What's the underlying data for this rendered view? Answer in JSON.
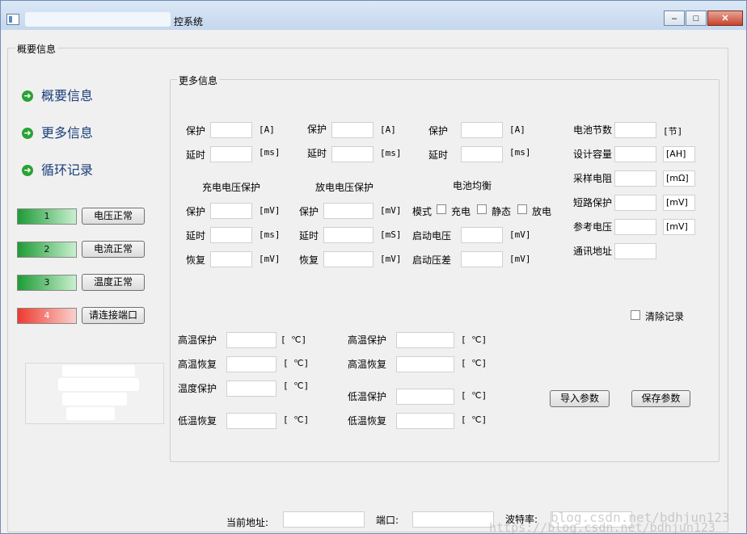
{
  "window": {
    "title": "控系统",
    "buttons": {
      "minimize": "–",
      "maximize": "□",
      "close": "✕"
    }
  },
  "overview_group_title": "概要信息",
  "sidebar": {
    "items": [
      {
        "label": "概要信息",
        "icon": "arrow-right-icon"
      },
      {
        "label": "更多信息",
        "icon": "arrow-right-icon"
      },
      {
        "label": "循环记录",
        "icon": "arrow-right-icon"
      }
    ]
  },
  "status": [
    {
      "num": "1",
      "label": "电压正常",
      "color": "#1e9b36"
    },
    {
      "num": "2",
      "label": "电流正常",
      "color": "#1e9b36"
    },
    {
      "num": "3",
      "label": "温度正常",
      "color": "#1e9b36"
    },
    {
      "num": "4",
      "label": "请连接端口",
      "color": "#ee3a2f"
    }
  ],
  "more": {
    "title": "更多信息",
    "current": [
      {
        "protect": "保护",
        "unit_a": "[A]",
        "delay": "延时",
        "unit_ms": "[ms]"
      },
      {
        "protect": "保护",
        "unit_a": "[A]",
        "delay": "延时",
        "unit_ms": "[ms]"
      },
      {
        "protect": "保护",
        "unit_a": "[A]",
        "delay": "延时",
        "unit_ms": "[ms]"
      }
    ],
    "charge": {
      "title": "充电电压保护",
      "protect": "保护",
      "protect_unit": "[mV]",
      "delay": "延时",
      "delay_unit": "[ms]",
      "recover": "恢复",
      "recover_unit": "[mV]"
    },
    "discharge": {
      "title": "放电电压保护",
      "protect": "保护",
      "protect_unit": "[mV]",
      "delay": "延时",
      "delay_unit": "[mS]",
      "recover": "恢复",
      "recover_unit": "[mV]"
    },
    "balance": {
      "title": "电池均衡",
      "mode": "模式",
      "opt_charge": "充电",
      "opt_static": "静态",
      "opt_discharge": "放电",
      "start_voltage": "启动电压",
      "start_voltage_unit": "[mV]",
      "start_diff": "启动压差",
      "start_diff_unit": "[mV]"
    },
    "battery": [
      {
        "label": "电池节数",
        "unit": "[节]"
      },
      {
        "label": "设计容量",
        "unit": "[AH]"
      },
      {
        "label": "采样电阻",
        "unit": "[mΩ]"
      },
      {
        "label": "短路保护",
        "unit": "[mV]"
      },
      {
        "label": "参考电压",
        "unit": "[mV]"
      },
      {
        "label": "通讯地址",
        "unit": ""
      }
    ],
    "clear_record": "清除记录",
    "temp_left": [
      {
        "label": "高温保护",
        "unit": "[ ℃]"
      },
      {
        "label": "高温恢复",
        "unit": "[ ℃]"
      },
      {
        "label": "温度保护",
        "unit": "[ ℃]"
      },
      {
        "label": "低温恢复",
        "unit": "[ ℃]"
      }
    ],
    "temp_right": [
      {
        "label": "高温保护",
        "unit": "[ ℃]"
      },
      {
        "label": "高温恢复",
        "unit": "[ ℃]"
      },
      {
        "label": "低温保护",
        "unit": "[ ℃]"
      },
      {
        "label": "低温恢复",
        "unit": "[ ℃]"
      }
    ],
    "import_button": "导入参数",
    "save_button": "保存参数"
  },
  "footer": {
    "address_label": "当前地址:",
    "port_label": "端口:",
    "baud_label": "波特率:"
  },
  "watermark": {
    "line1": "blog.csdn.net/bdhjun123",
    "line2": "https://blog.csdn.net/bdhjun123"
  }
}
